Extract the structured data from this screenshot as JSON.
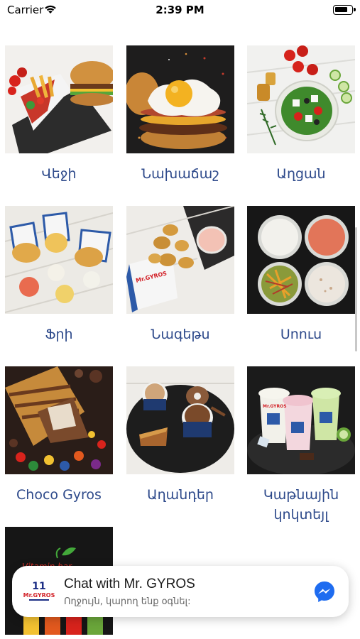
{
  "status_bar": {
    "carrier": "Carrier",
    "time": "2:39 PM"
  },
  "menu": {
    "items": [
      {
        "label": "Վեջի",
        "image": "wrap-and-burger"
      },
      {
        "label": "Նախաճաշ",
        "image": "egg-burger"
      },
      {
        "label": "Աղցան",
        "image": "greek-salad"
      },
      {
        "label": "Ֆրի",
        "image": "fries-cups"
      },
      {
        "label": "Նագեթս",
        "image": "nuggets-box"
      },
      {
        "label": "Սոուս",
        "image": "sauce-bowls"
      },
      {
        "label": "Choco Gyros",
        "image": "chocolate-crepe"
      },
      {
        "label": "Աղանդեր",
        "image": "coffee-and-dessert"
      },
      {
        "label": "Կաթնային կոկտեյլ",
        "image": "milkshakes"
      },
      {
        "label": "",
        "image": "vitamin-bar-drinks"
      }
    ]
  },
  "chat_banner": {
    "title": "Chat with Mr. GYROS",
    "subtitle": "Ողջույն, կարող ենք օգնել:",
    "logo_text": "Mr.GYROS",
    "icon": "messenger-icon"
  },
  "colors": {
    "label": "#2e4a8b",
    "messenger": "#1e6cf0",
    "logo_red": "#d21f26",
    "logo_blue": "#1b2d84"
  }
}
